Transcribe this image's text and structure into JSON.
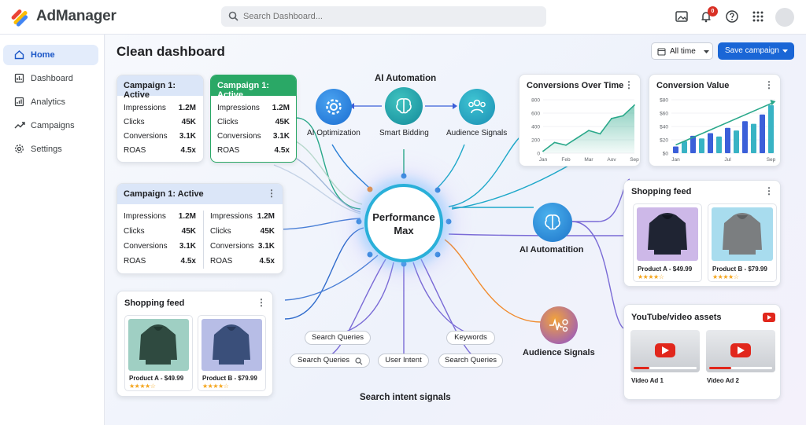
{
  "app": {
    "name": "AdManager"
  },
  "search": {
    "placeholder": "Search Dashboard..."
  },
  "header": {
    "notification_count": "0"
  },
  "sidebar": {
    "items": [
      {
        "label": "Home",
        "icon": "home-icon"
      },
      {
        "label": "Dashboard",
        "icon": "dashboard-icon"
      },
      {
        "label": "Analytics",
        "icon": "analytics-icon"
      },
      {
        "label": "Campaigns",
        "icon": "trending-icon"
      },
      {
        "label": "Settings",
        "icon": "gear-icon"
      }
    ]
  },
  "page": {
    "title": "Clean dashboard",
    "filter_label": "All time",
    "save_label": "Save campaign"
  },
  "campaigns": {
    "card1": {
      "title": "Campaign 1: Active",
      "metrics": [
        {
          "k": "Impressions",
          "v": "1.2M"
        },
        {
          "k": "Clicks",
          "v": "45K"
        },
        {
          "k": "Conversions",
          "v": "3.1K"
        },
        {
          "k": "ROAS",
          "v": "4.5x"
        }
      ]
    },
    "card2": {
      "title": "Campaign 1: Active",
      "metrics": [
        {
          "k": "Impressions",
          "v": "1.2M"
        },
        {
          "k": "Clicks",
          "v": "45K"
        },
        {
          "k": "Conversions",
          "v": "3.1K"
        },
        {
          "k": "ROAS",
          "v": "4.5x"
        }
      ]
    },
    "card3": {
      "title": "Campaign 1: Active",
      "left": [
        {
          "k": "Impressions",
          "v": "1.2M"
        },
        {
          "k": "Clicks",
          "v": "45K"
        },
        {
          "k": "Conversions",
          "v": "3.1K"
        },
        {
          "k": "ROAS",
          "v": "4.5x"
        }
      ],
      "right": [
        {
          "k": "Impressions",
          "v": "1.2M"
        },
        {
          "k": "Clicks",
          "v": "45K"
        },
        {
          "k": "Conversions",
          "v": "3.1K"
        },
        {
          "k": "ROAS",
          "v": "4.5x"
        }
      ]
    }
  },
  "flow": {
    "top_title": "AI Automation",
    "nodes": {
      "ai_optimization": "AI Optimization",
      "smart_bidding": "Smart Bidding",
      "audience_signals_top": "Audience Signals",
      "ai_automatition": "AI Automatition",
      "audience_signals_bottom": "Audience Signals"
    },
    "hub": {
      "line1": "Performance",
      "line2": "Max"
    },
    "pills": [
      "Search Queries",
      "Keywords",
      "Search Queries",
      "User Intent",
      "Search Queries"
    ],
    "bottom_title": "Search intent signals"
  },
  "shopping_left": {
    "title": "Shopping feed",
    "products": [
      {
        "name": "Product A - $49.99",
        "rating": "★★★★☆",
        "color": "#2f4a40"
      },
      {
        "name": "Product B - $79.99",
        "rating": "★★★★☆",
        "color": "#3a4f7a"
      }
    ]
  },
  "shopping_right": {
    "title": "Shopping feed",
    "products": [
      {
        "name": "Product A - $49.99",
        "rating": "★★★★☆",
        "color": "#1f2433"
      },
      {
        "name": "Product B - $79.99",
        "rating": "★★★★☆",
        "color": "#7b7e80"
      }
    ]
  },
  "videos": {
    "title": "YouTube/video assets",
    "items": [
      {
        "label": "Video Ad 1",
        "progress": 0.25
      },
      {
        "label": "Video Ad 2",
        "progress": 0.35
      }
    ]
  },
  "chart_data": [
    {
      "type": "area",
      "title": "Conversions Over Time",
      "categories": [
        "Jan",
        "Feb",
        "Mar",
        "Aov",
        "Sep"
      ],
      "yticks": [
        "800",
        "600",
        "400",
        "200",
        "0"
      ],
      "ylim": [
        0,
        800
      ],
      "x": [
        0,
        0.5,
        1,
        1.5,
        2,
        2.5,
        3,
        3.5,
        4
      ],
      "values": [
        30,
        160,
        120,
        230,
        340,
        290,
        520,
        560,
        720
      ],
      "color": "#2aa88a"
    },
    {
      "type": "bar",
      "title": "Conversion Value",
      "categories": [
        "Jan",
        "Jul",
        "Sep"
      ],
      "yticks": [
        "$80",
        "$60",
        "$40",
        "$20",
        "$0"
      ],
      "ylim": [
        0,
        80
      ],
      "values": [
        10,
        18,
        26,
        22,
        30,
        25,
        38,
        34,
        48,
        44,
        58,
        72
      ],
      "trend": [
        10,
        73
      ],
      "color": "#3b5fd9",
      "trend_color": "#2aa88a"
    }
  ]
}
